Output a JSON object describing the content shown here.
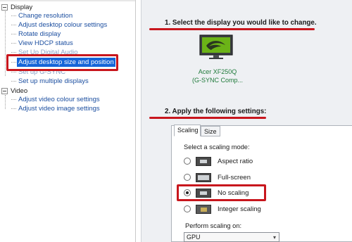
{
  "nav": {
    "display_category": "Display",
    "video_category": "Video",
    "display_items": [
      {
        "label": "Change resolution",
        "selected": false
      },
      {
        "label": "Adjust desktop colour settings",
        "selected": false
      },
      {
        "label": "Rotate display",
        "selected": false
      },
      {
        "label": "View HDCP status",
        "selected": false
      },
      {
        "label": "Set Up Digital Audio",
        "selected": false
      },
      {
        "label": "Adjust desktop size and position",
        "selected": true
      },
      {
        "label": "Set up G-SYNC",
        "selected": false
      },
      {
        "label": "Set up multiple displays",
        "selected": false
      }
    ],
    "video_items": [
      {
        "label": "Adjust video colour settings",
        "selected": false
      },
      {
        "label": "Adjust video image settings",
        "selected": false
      }
    ]
  },
  "main": {
    "step1_title": "1. Select the display you would like to change.",
    "monitor": {
      "name_line1": "Acer XF250Q",
      "name_line2": "(G-SYNC Comp...",
      "icon": "monitor-nvidia-icon"
    },
    "step2_title": "2. Apply the following settings:",
    "tabs": [
      {
        "label": "Scaling",
        "active": true
      },
      {
        "label": "Size",
        "active": false
      }
    ],
    "scaling_mode_label": "Select a scaling mode:",
    "scaling_modes": [
      {
        "label": "Aspect ratio",
        "checked": false,
        "icon": "aspect-ratio-icon"
      },
      {
        "label": "Full-screen",
        "checked": false,
        "icon": "full-screen-icon"
      },
      {
        "label": "No scaling",
        "checked": true,
        "icon": "no-scaling-icon"
      },
      {
        "label": "Integer scaling",
        "checked": false,
        "icon": "integer-scaling-icon"
      }
    ],
    "perform_scaling_label": "Perform scaling on:",
    "perform_scaling_value": "GPU"
  },
  "colors": {
    "highlight_red": "#c8161d",
    "selection_blue": "#1565d8",
    "link_blue": "#1c4fa0",
    "monitor_name_green": "#1f7a3a"
  }
}
